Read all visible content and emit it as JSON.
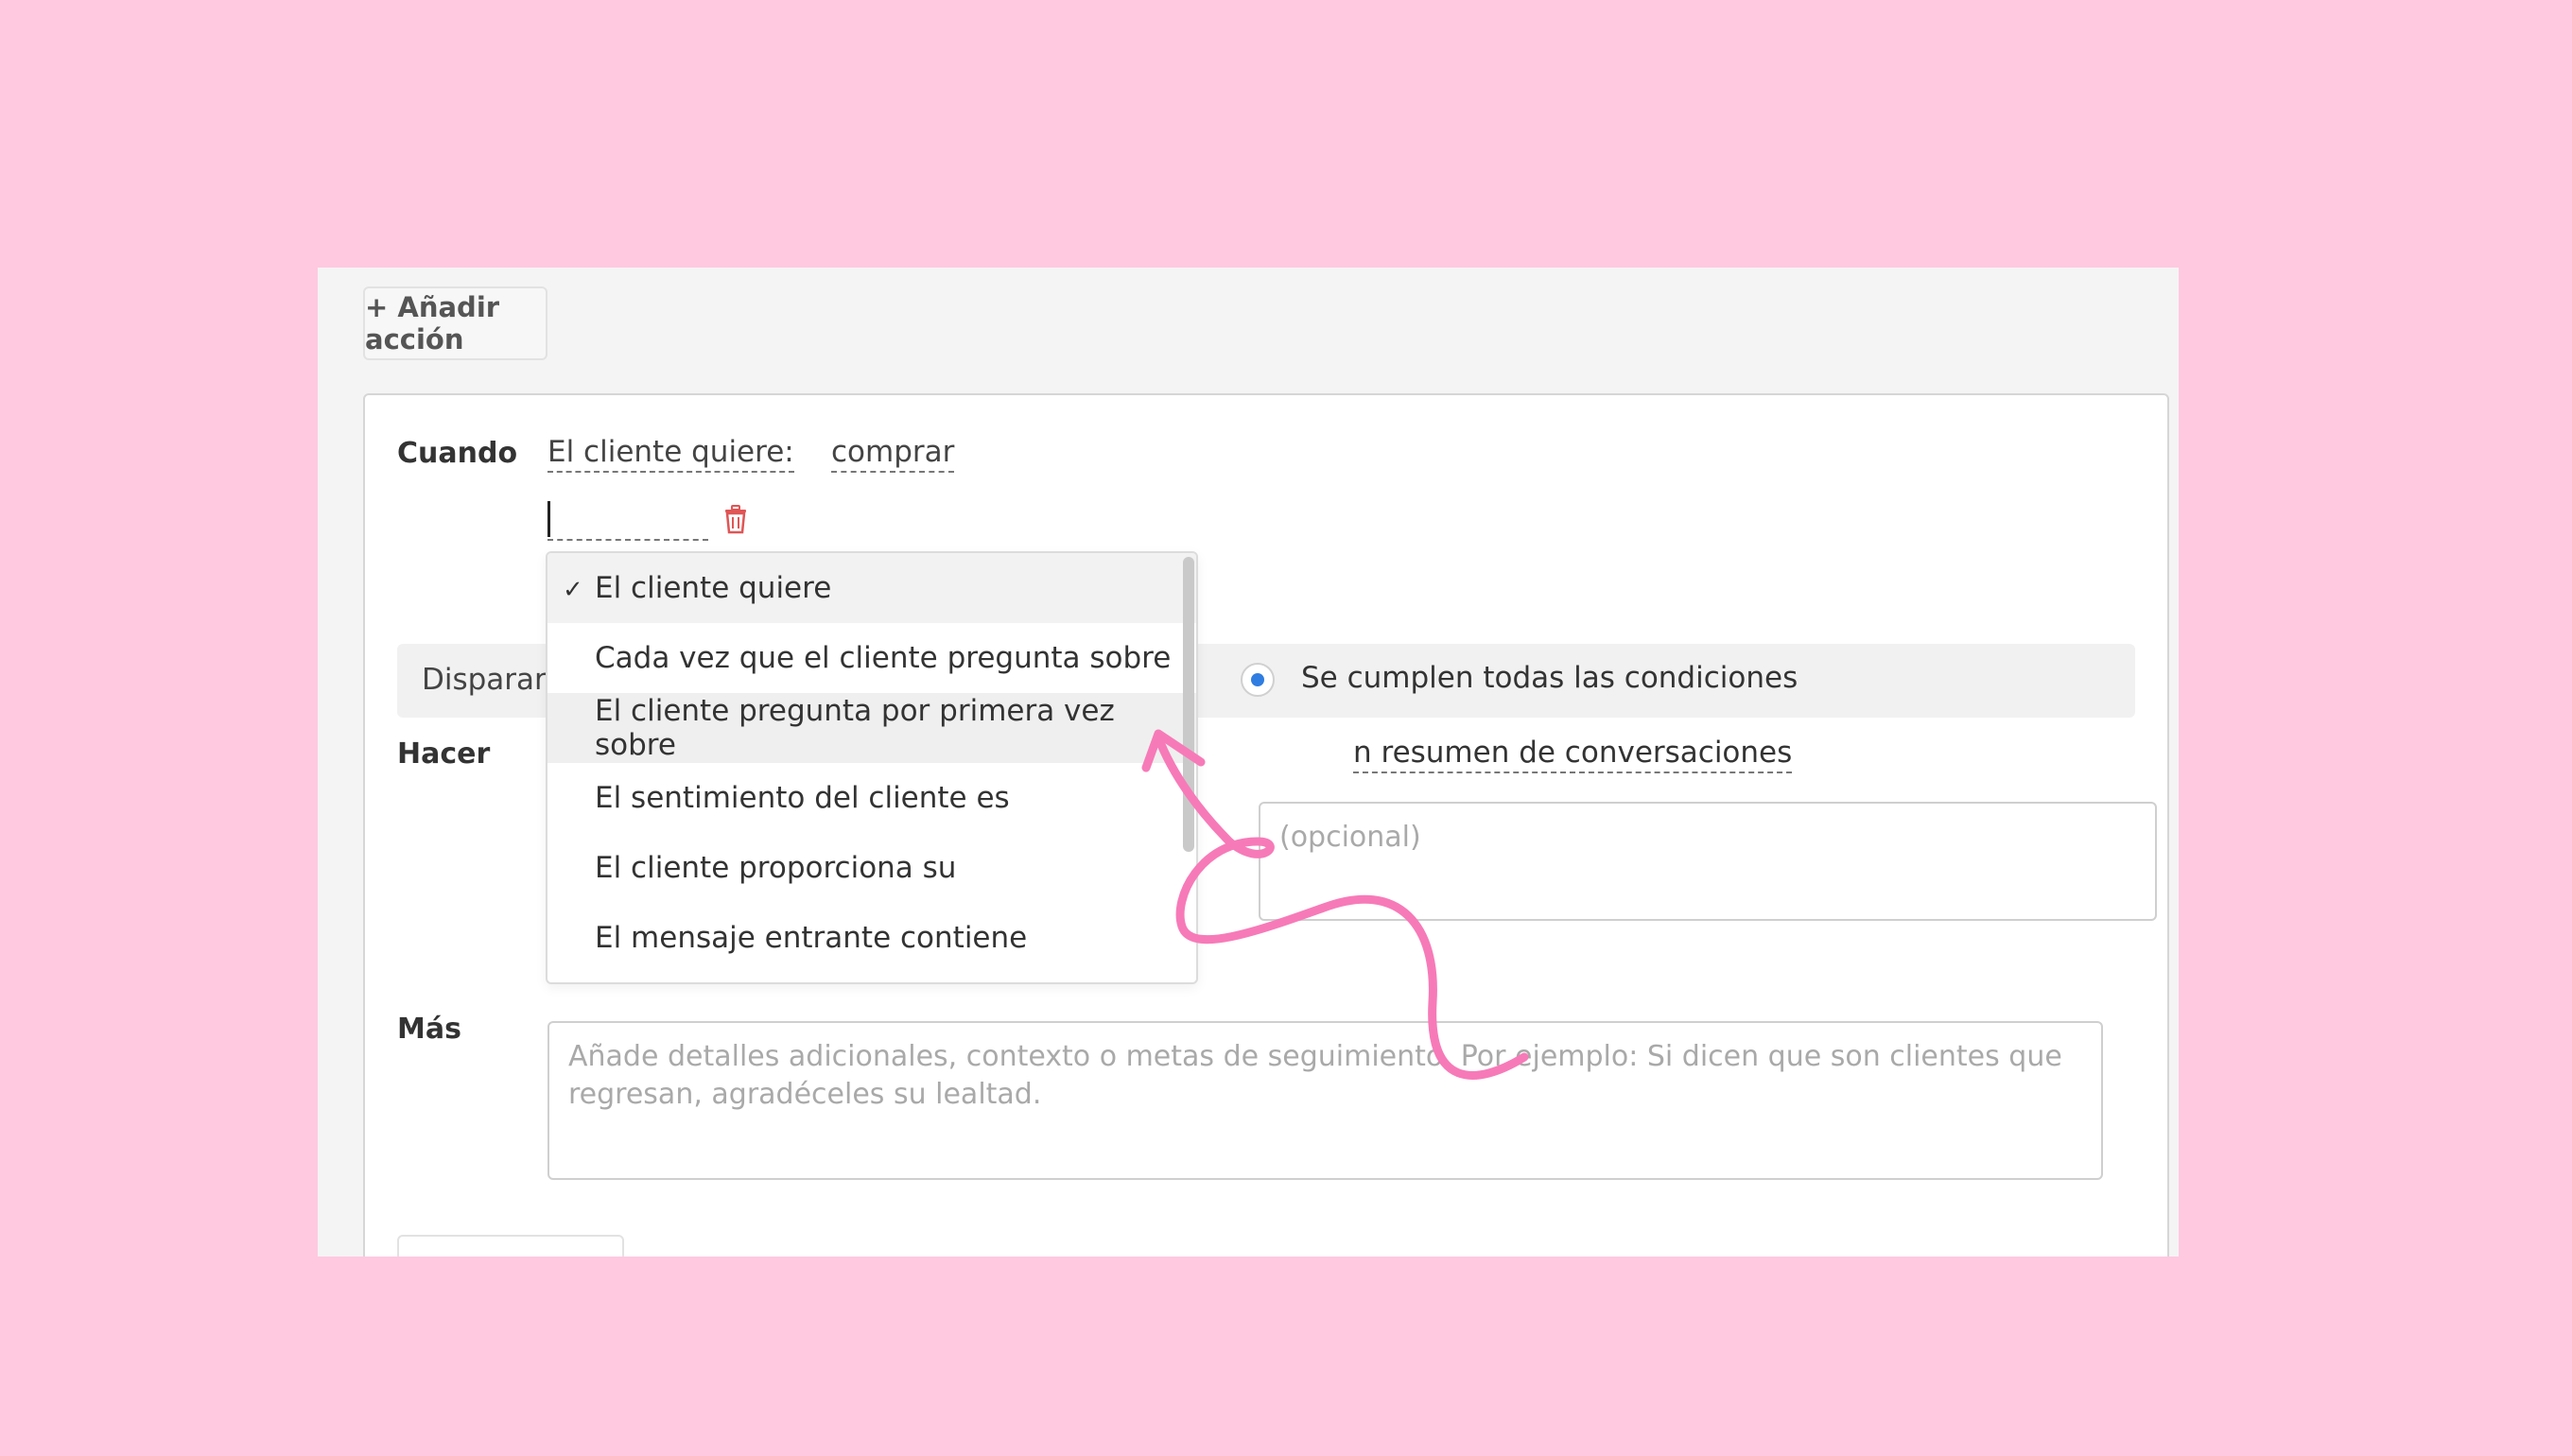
{
  "toolbar": {
    "add_action_label": "+ Añadir acción"
  },
  "when": {
    "label": "Cuando",
    "condition_type": "El cliente quiere:",
    "condition_value": "comprar"
  },
  "trigger": {
    "label_visible": "Disparar a",
    "selected_option": "Se cumplen todas las condiciones"
  },
  "do": {
    "label": "Hacer",
    "action_visible": "n resumen de conversaciones",
    "placeholder_visible": "(opcional)"
  },
  "more": {
    "label": "Más",
    "placeholder": "Añade detalles adicionales, contexto o metas de seguimiento. Por ejemplo: Si dicen que son clientes que regresan, agradéceles su lealtad."
  },
  "dropdown": {
    "check_glyph": "✓",
    "items": [
      {
        "label": "El cliente quiere",
        "selected": true
      },
      {
        "label": "Cada vez que el cliente pregunta sobre"
      },
      {
        "label": "El cliente pregunta por primera vez sobre",
        "hovered": true
      },
      {
        "label": "El sentimiento del cliente es"
      },
      {
        "label": "El cliente proporciona su"
      },
      {
        "label": "El mensaje entrante contiene"
      }
    ]
  },
  "colors": {
    "background": "#ffc9e0",
    "accent_radio": "#2f7de1",
    "annotation": "#f77ab8",
    "trash": "#e05555"
  },
  "icons": {
    "trash": "trash-icon",
    "check": "check-icon"
  }
}
